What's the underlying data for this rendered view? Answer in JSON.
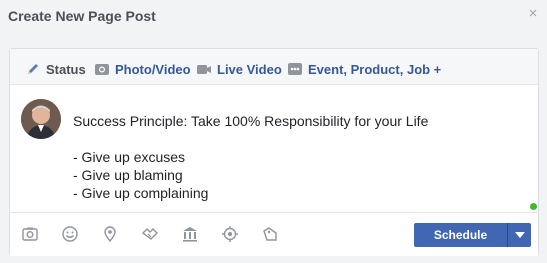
{
  "header": {
    "title": "Create New Page Post"
  },
  "tabs": [
    {
      "label": "Status",
      "icon": "pencil-icon"
    },
    {
      "label": "Photo/Video",
      "icon": "camera-icon"
    },
    {
      "label": "Live Video",
      "icon": "video-camera-icon"
    },
    {
      "label": "Event, Product, Job +",
      "icon": "more-icon"
    }
  ],
  "composer": {
    "text": "Success Principle: Take 100% Responsibility for your Life\n\n- Give up excuses\n- Give up blaming\n- Give up complaining"
  },
  "footer": {
    "icons": [
      "camera-icon",
      "emoji-icon",
      "location-icon",
      "handshake-icon",
      "bank-icon",
      "target-icon",
      "tag-icon"
    ],
    "schedule_label": "Schedule"
  },
  "colors": {
    "accent": "#4267b2",
    "link": "#365899",
    "online": "#42b72a"
  }
}
